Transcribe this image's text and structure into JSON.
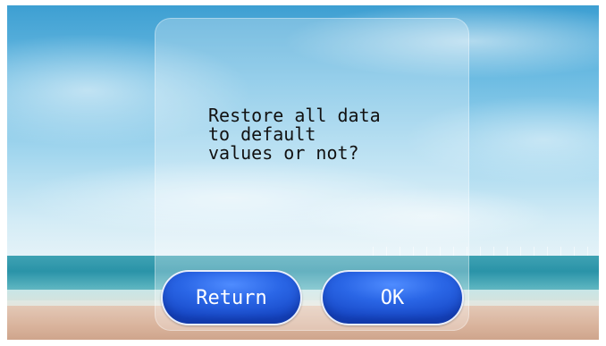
{
  "dialog": {
    "message": "Restore all data\nto default\nvalues or not?"
  },
  "buttons": {
    "return_label": "Return",
    "ok_label": "OK"
  },
  "colors": {
    "button_blue": "#2a66e6",
    "panel_overlay": "rgba(255,255,255,0.28)"
  },
  "background": {
    "scene": "beach-sky-sea-wallpaper"
  }
}
